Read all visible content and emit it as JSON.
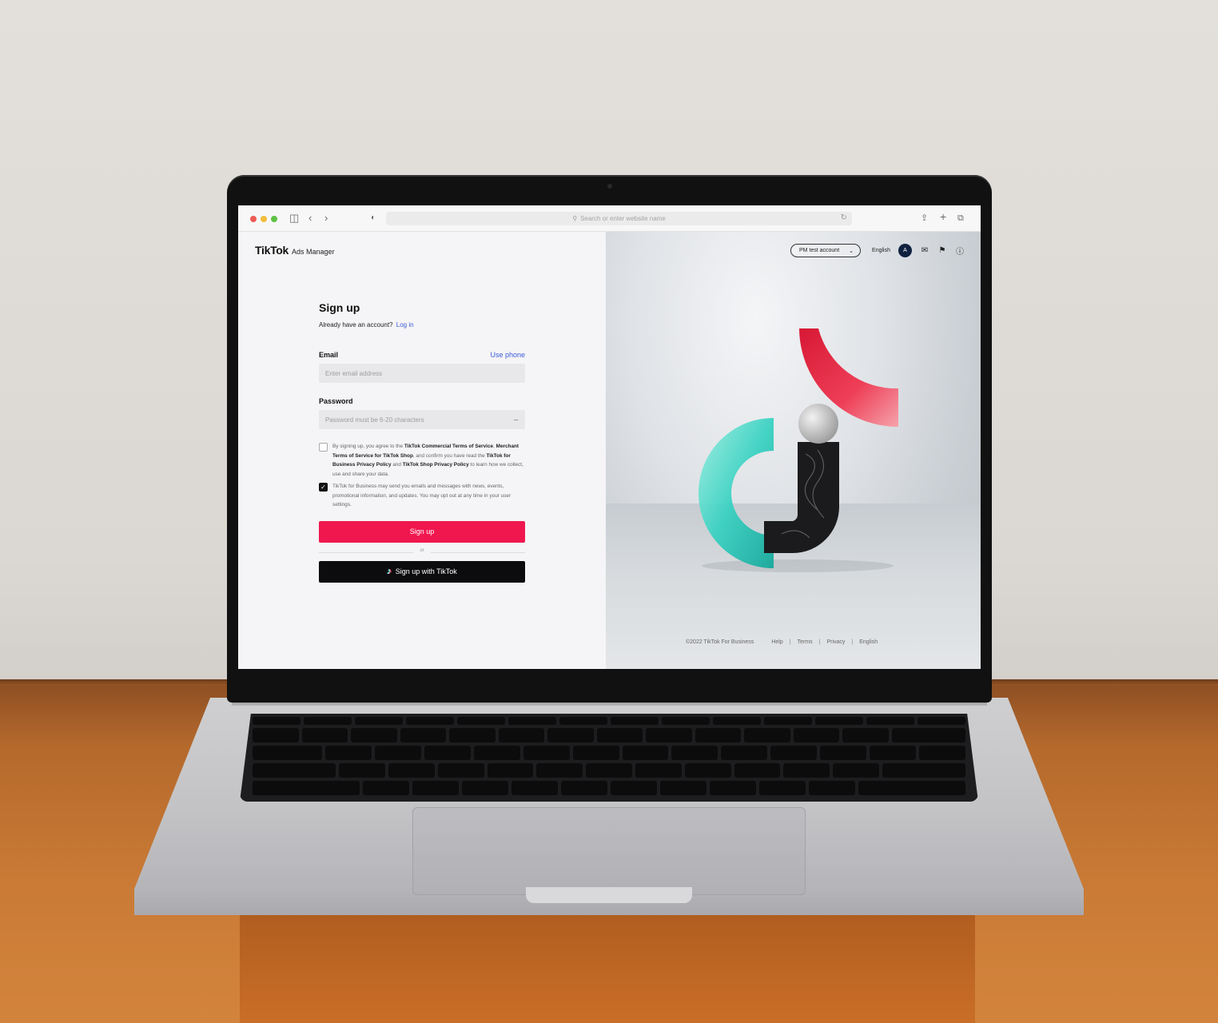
{
  "browser": {
    "address_placeholder": "Search or enter website name"
  },
  "brand": {
    "logo": "TikTok",
    "product": "Ads Manager"
  },
  "form": {
    "title": "Sign up",
    "already_text": "Already have an account?",
    "login_link": "Log in",
    "email_label": "Email",
    "use_phone": "Use phone",
    "email_placeholder": "Enter email address",
    "password_label": "Password",
    "password_placeholder": "Password must be 6-20 characters",
    "terms": {
      "t1": "By signing up, you agree to the ",
      "b1": "TikTok Commercial Terms of Service",
      "t2": ", ",
      "b2": "Merchant Terms of Service for TikTok Shop",
      "t3": ", and confirm you have read the ",
      "b3": "TikTok for Business Privacy Policy",
      "t4": " and ",
      "b4": "TikTok Shop Privacy Policy",
      "t5": " to learn how we collect, use and share your data.",
      "checked": false
    },
    "marketing": {
      "text": "TikTok for Business may send you emails and messages with news, events, promotional information, and updates. You may opt out at any time in your user settings.",
      "checked": true
    },
    "signup_button": "Sign up",
    "or": "or",
    "tiktok_button": "Sign up with TikTok"
  },
  "header": {
    "account": "PM test account",
    "language": "English",
    "avatar_initial": "A"
  },
  "footer": {
    "copyright": "©2022 TikTok For Business",
    "links": [
      "Help",
      "Terms",
      "Privacy",
      "English"
    ]
  },
  "colors": {
    "accent_red": "#f0174f",
    "link_blue": "#3b5bd9",
    "dark_button": "#0c0c0f"
  }
}
